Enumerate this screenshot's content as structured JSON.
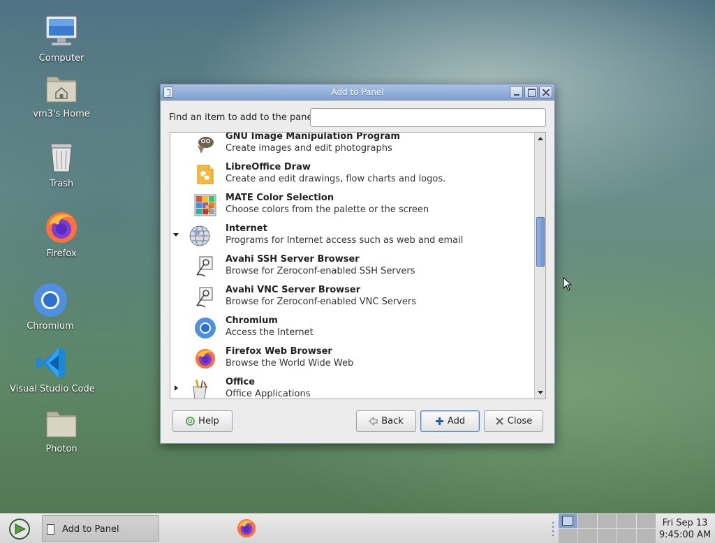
{
  "desktop": {
    "icons": [
      {
        "label": "Computer",
        "icon": "computer-icon"
      },
      {
        "label": "vm3's Home",
        "icon": "home-folder-icon"
      },
      {
        "label": "Trash",
        "icon": "trash-icon"
      },
      {
        "label": "Firefox",
        "icon": "firefox-icon"
      },
      {
        "label": "Chromium",
        "icon": "chromium-icon"
      },
      {
        "label": "Visual Studio Code",
        "icon": "vscode-icon"
      },
      {
        "label": "Photon",
        "icon": "folder-icon"
      }
    ]
  },
  "dialog": {
    "title": "Add to Panel",
    "find_label": "Find an item to add to the panel:",
    "search_value": "",
    "items": [
      {
        "name": "GNU Image Manipulation Program",
        "desc": "Create images and edit photographs",
        "icon": "gimp-icon"
      },
      {
        "name": "LibreOffice Draw",
        "desc": "Create and edit drawings, flow charts and logos.",
        "icon": "libreoffice-draw-icon"
      },
      {
        "name": "MATE Color Selection",
        "desc": "Choose colors from the palette or the screen",
        "icon": "color-selection-icon"
      },
      {
        "name": "Internet",
        "desc": "Programs for Internet access such as web and email",
        "icon": "globe-icon",
        "expander": "expanded"
      },
      {
        "name": "Avahi SSH Server Browser",
        "desc": "Browse for Zeroconf-enabled SSH Servers",
        "icon": "avahi-ssh-icon"
      },
      {
        "name": "Avahi VNC Server Browser",
        "desc": "Browse for Zeroconf-enabled VNC Servers",
        "icon": "avahi-vnc-icon"
      },
      {
        "name": "Chromium",
        "desc": "Access the Internet",
        "icon": "chromium-icon"
      },
      {
        "name": "Firefox Web Browser",
        "desc": "Browse the World Wide Web",
        "icon": "firefox-icon"
      },
      {
        "name": "Office",
        "desc": "Office Applications",
        "icon": "office-icon",
        "expander": "collapsed"
      }
    ],
    "buttons": {
      "help": "Help",
      "back": "Back",
      "add": "Add",
      "close": "Close"
    }
  },
  "taskbar": {
    "window_button": "Add to Panel",
    "clock_date": "Fri Sep 13",
    "clock_time": "9:45:00 AM",
    "workspace_count": 10,
    "active_workspace": 1
  }
}
